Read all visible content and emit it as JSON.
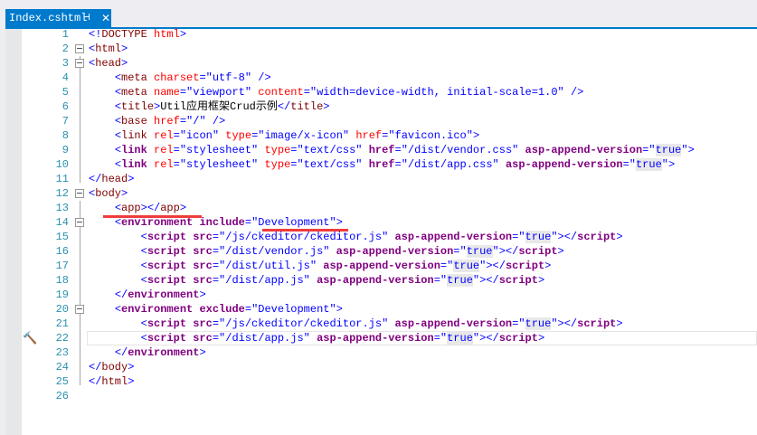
{
  "tab": {
    "title": "Index.cshtml",
    "pin": "⊣",
    "close": "✕"
  },
  "lines": [
    [
      [
        "d",
        "<!"
      ],
      [
        "n",
        "DOCTYPE"
      ],
      [
        "x",
        " "
      ],
      [
        "a",
        "html"
      ],
      [
        "d",
        ">"
      ]
    ],
    [
      [
        "d",
        "<"
      ],
      [
        "n",
        "html"
      ],
      [
        "d",
        ">"
      ]
    ],
    [
      [
        "d",
        "<"
      ],
      [
        "n",
        "head"
      ],
      [
        "d",
        ">"
      ]
    ],
    [
      [
        "x",
        "    "
      ],
      [
        "d",
        "<"
      ],
      [
        "n",
        "meta"
      ],
      [
        "x",
        " "
      ],
      [
        "a",
        "charset"
      ],
      [
        "d",
        "="
      ],
      [
        "v",
        "\"utf-8\""
      ],
      [
        "x",
        " "
      ],
      [
        "d",
        "/>"
      ]
    ],
    [
      [
        "x",
        "    "
      ],
      [
        "d",
        "<"
      ],
      [
        "n",
        "meta"
      ],
      [
        "x",
        " "
      ],
      [
        "a",
        "name"
      ],
      [
        "d",
        "="
      ],
      [
        "v",
        "\"viewport\""
      ],
      [
        "x",
        " "
      ],
      [
        "a",
        "content"
      ],
      [
        "d",
        "="
      ],
      [
        "v",
        "\"width=device-width, initial-scale=1.0\""
      ],
      [
        "x",
        " "
      ],
      [
        "d",
        "/>"
      ]
    ],
    [
      [
        "x",
        "    "
      ],
      [
        "d",
        "<"
      ],
      [
        "n",
        "title"
      ],
      [
        "d",
        ">"
      ],
      [
        "x",
        "Util应用框架Crud示例"
      ],
      [
        "d",
        "</"
      ],
      [
        "n",
        "title"
      ],
      [
        "d",
        ">"
      ]
    ],
    [
      [
        "x",
        "    "
      ],
      [
        "d",
        "<"
      ],
      [
        "n",
        "base"
      ],
      [
        "x",
        " "
      ],
      [
        "a",
        "href"
      ],
      [
        "d",
        "="
      ],
      [
        "v",
        "\"/\""
      ],
      [
        "x",
        " "
      ],
      [
        "d",
        "/>"
      ]
    ],
    [
      [
        "x",
        "    "
      ],
      [
        "d",
        "<"
      ],
      [
        "n",
        "link"
      ],
      [
        "x",
        " "
      ],
      [
        "a",
        "rel"
      ],
      [
        "d",
        "="
      ],
      [
        "v",
        "\"icon\""
      ],
      [
        "x",
        " "
      ],
      [
        "a",
        "type"
      ],
      [
        "d",
        "="
      ],
      [
        "v",
        "\"image/x-icon\""
      ],
      [
        "x",
        " "
      ],
      [
        "a",
        "href"
      ],
      [
        "d",
        "="
      ],
      [
        "v",
        "\"favicon.ico\""
      ],
      [
        "d",
        ">"
      ]
    ],
    [
      [
        "x",
        "    "
      ],
      [
        "d",
        "<"
      ],
      [
        "h",
        "link"
      ],
      [
        "x",
        " "
      ],
      [
        "a",
        "rel"
      ],
      [
        "d",
        "="
      ],
      [
        "v",
        "\"stylesheet\""
      ],
      [
        "x",
        " "
      ],
      [
        "a",
        "type"
      ],
      [
        "d",
        "="
      ],
      [
        "v",
        "\"text/css\""
      ],
      [
        "x",
        " "
      ],
      [
        "h",
        "href"
      ],
      [
        "d",
        "="
      ],
      [
        "v",
        "\"/dist/vendor.css\""
      ],
      [
        "x",
        " "
      ],
      [
        "h",
        "asp-append-version"
      ],
      [
        "d",
        "="
      ],
      [
        "v",
        "\""
      ],
      [
        "hv",
        "true"
      ],
      [
        "v",
        "\""
      ],
      [
        "d",
        ">"
      ]
    ],
    [
      [
        "x",
        "    "
      ],
      [
        "d",
        "<"
      ],
      [
        "h",
        "link"
      ],
      [
        "x",
        " "
      ],
      [
        "a",
        "rel"
      ],
      [
        "d",
        "="
      ],
      [
        "v",
        "\"stylesheet\""
      ],
      [
        "x",
        " "
      ],
      [
        "a",
        "type"
      ],
      [
        "d",
        "="
      ],
      [
        "v",
        "\"text/css\""
      ],
      [
        "x",
        " "
      ],
      [
        "h",
        "href"
      ],
      [
        "d",
        "="
      ],
      [
        "v",
        "\"/dist/app.css\""
      ],
      [
        "x",
        " "
      ],
      [
        "h",
        "asp-append-version"
      ],
      [
        "d",
        "="
      ],
      [
        "v",
        "\""
      ],
      [
        "hv",
        "true"
      ],
      [
        "v",
        "\""
      ],
      [
        "d",
        ">"
      ]
    ],
    [
      [
        "d",
        "</"
      ],
      [
        "n",
        "head"
      ],
      [
        "d",
        ">"
      ]
    ],
    [
      [
        "d",
        "<"
      ],
      [
        "n",
        "body"
      ],
      [
        "d",
        ">"
      ]
    ],
    [
      [
        "x",
        "    "
      ],
      [
        "d",
        "<"
      ],
      [
        "n",
        "app"
      ],
      [
        "d",
        "></"
      ],
      [
        "n",
        "app"
      ],
      [
        "d",
        ">"
      ]
    ],
    [
      [
        "x",
        "    "
      ],
      [
        "d",
        "<"
      ],
      [
        "h",
        "environment"
      ],
      [
        "x",
        " "
      ],
      [
        "h",
        "include"
      ],
      [
        "d",
        "="
      ],
      [
        "v",
        "\"Development\""
      ],
      [
        "d",
        ">"
      ]
    ],
    [
      [
        "x",
        "        "
      ],
      [
        "d",
        "<"
      ],
      [
        "h",
        "script"
      ],
      [
        "x",
        " "
      ],
      [
        "h",
        "src"
      ],
      [
        "d",
        "="
      ],
      [
        "v",
        "\"/js/ckeditor/ckeditor.js\""
      ],
      [
        "x",
        " "
      ],
      [
        "h",
        "asp-append-version"
      ],
      [
        "d",
        "="
      ],
      [
        "v",
        "\""
      ],
      [
        "hv",
        "true"
      ],
      [
        "v",
        "\""
      ],
      [
        "d",
        "></"
      ],
      [
        "h",
        "script"
      ],
      [
        "d",
        ">"
      ]
    ],
    [
      [
        "x",
        "        "
      ],
      [
        "d",
        "<"
      ],
      [
        "h",
        "script"
      ],
      [
        "x",
        " "
      ],
      [
        "h",
        "src"
      ],
      [
        "d",
        "="
      ],
      [
        "v",
        "\"/dist/vendor.js\""
      ],
      [
        "x",
        " "
      ],
      [
        "h",
        "asp-append-version"
      ],
      [
        "d",
        "="
      ],
      [
        "v",
        "\""
      ],
      [
        "hv",
        "true"
      ],
      [
        "v",
        "\""
      ],
      [
        "d",
        "></"
      ],
      [
        "h",
        "script"
      ],
      [
        "d",
        ">"
      ]
    ],
    [
      [
        "x",
        "        "
      ],
      [
        "d",
        "<"
      ],
      [
        "h",
        "script"
      ],
      [
        "x",
        " "
      ],
      [
        "h",
        "src"
      ],
      [
        "d",
        "="
      ],
      [
        "v",
        "\"/dist/util.js\""
      ],
      [
        "x",
        " "
      ],
      [
        "h",
        "asp-append-version"
      ],
      [
        "d",
        "="
      ],
      [
        "v",
        "\""
      ],
      [
        "hv",
        "true"
      ],
      [
        "v",
        "\""
      ],
      [
        "d",
        "></"
      ],
      [
        "h",
        "script"
      ],
      [
        "d",
        ">"
      ]
    ],
    [
      [
        "x",
        "        "
      ],
      [
        "d",
        "<"
      ],
      [
        "h",
        "script"
      ],
      [
        "x",
        " "
      ],
      [
        "h",
        "src"
      ],
      [
        "d",
        "="
      ],
      [
        "v",
        "\"/dist/app.js\""
      ],
      [
        "x",
        " "
      ],
      [
        "h",
        "asp-append-version"
      ],
      [
        "d",
        "="
      ],
      [
        "v",
        "\""
      ],
      [
        "hv",
        "true"
      ],
      [
        "v",
        "\""
      ],
      [
        "d",
        "></"
      ],
      [
        "h",
        "script"
      ],
      [
        "d",
        ">"
      ]
    ],
    [
      [
        "x",
        "    "
      ],
      [
        "d",
        "</"
      ],
      [
        "h",
        "environment"
      ],
      [
        "d",
        ">"
      ]
    ],
    [
      [
        "x",
        "    "
      ],
      [
        "d",
        "<"
      ],
      [
        "h",
        "environment"
      ],
      [
        "x",
        " "
      ],
      [
        "h",
        "exclude"
      ],
      [
        "d",
        "="
      ],
      [
        "v",
        "\"Development\""
      ],
      [
        "d",
        ">"
      ]
    ],
    [
      [
        "x",
        "        "
      ],
      [
        "d",
        "<"
      ],
      [
        "h",
        "script"
      ],
      [
        "x",
        " "
      ],
      [
        "h",
        "src"
      ],
      [
        "d",
        "="
      ],
      [
        "v",
        "\"/js/ckeditor/ckeditor.js\""
      ],
      [
        "x",
        " "
      ],
      [
        "h",
        "asp-append-version"
      ],
      [
        "d",
        "="
      ],
      [
        "v",
        "\""
      ],
      [
        "hv",
        "true"
      ],
      [
        "v",
        "\""
      ],
      [
        "d",
        "></"
      ],
      [
        "h",
        "script"
      ],
      [
        "d",
        ">"
      ]
    ],
    [
      [
        "x",
        "        "
      ],
      [
        "d",
        "<"
      ],
      [
        "h",
        "script"
      ],
      [
        "x",
        " "
      ],
      [
        "h",
        "src"
      ],
      [
        "d",
        "="
      ],
      [
        "v",
        "\"/dist/app.js\""
      ],
      [
        "x",
        " "
      ],
      [
        "h",
        "asp-append-version"
      ],
      [
        "d",
        "="
      ],
      [
        "v",
        "\""
      ],
      [
        "hv",
        "true"
      ],
      [
        "v",
        "\""
      ],
      [
        "d",
        "></"
      ],
      [
        "h",
        "script"
      ],
      [
        "d",
        ">"
      ]
    ],
    [
      [
        "x",
        "    "
      ],
      [
        "d",
        "</"
      ],
      [
        "h",
        "environment"
      ],
      [
        "d",
        ">"
      ]
    ],
    [
      [
        "d",
        "</"
      ],
      [
        "n",
        "body"
      ],
      [
        "d",
        ">"
      ]
    ],
    [
      [
        "d",
        "</"
      ],
      [
        "n",
        "html"
      ],
      [
        "d",
        ">"
      ]
    ],
    []
  ],
  "folds": [
    2,
    3,
    12,
    14,
    20
  ],
  "current_line": 22
}
